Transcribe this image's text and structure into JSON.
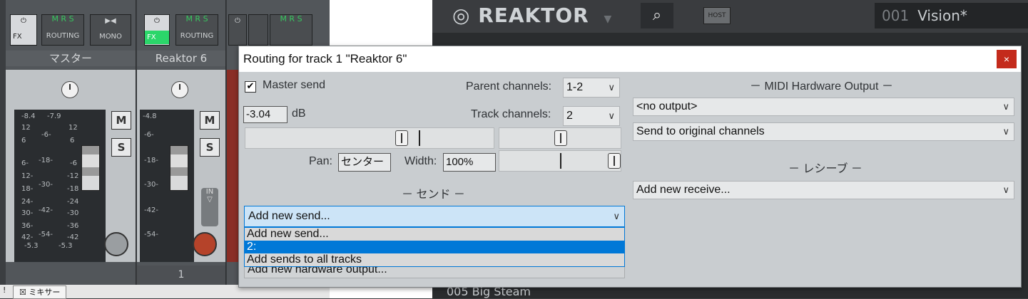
{
  "mixer": {
    "top_buttons": {
      "fx": "FX",
      "routing": "ROUTING",
      "mono": "MONO",
      "m": "M",
      "r": "R",
      "s": "S",
      "in": "IN"
    },
    "strips": [
      {
        "name": "マスター",
        "meter_labels": [
          "-8.4",
          "-7.9",
          "12",
          "-6-",
          "12",
          "6",
          "6",
          "6-",
          "-18-",
          "-6",
          "12-",
          "-12",
          "18-",
          "-30-",
          "-18",
          "24-",
          "-24",
          "30-",
          "-42-",
          "-30",
          "36-",
          "-36",
          "42-",
          "-54-",
          "-42",
          "-5.3",
          "-5.3"
        ]
      },
      {
        "name": "Reaktor 6",
        "number": "1",
        "meter_labels": [
          "-4.8",
          "-6-",
          "-18-",
          "-30-",
          "-42-",
          "-54-"
        ]
      }
    ],
    "m_label": "M",
    "s_label": "S",
    "bottom_tab": "ミキサー",
    "bottom_prefix": "!"
  },
  "reaktor": {
    "logo": "REAKTOR",
    "host_label": "HOST",
    "preset_number": "001",
    "preset_name": "Vision*",
    "list_item": "005   Big Steam"
  },
  "dialog": {
    "title": "Routing for track 1 \"Reaktor 6\"",
    "close_label": "×",
    "master_send_label": "Master send",
    "master_send_checked": true,
    "parent_channels_label": "Parent channels:",
    "parent_channels_value": "1-2",
    "volume_value": "-3.04",
    "volume_unit": "dB",
    "track_channels_label": "Track channels:",
    "track_channels_value": "2",
    "pan_label": "Pan:",
    "pan_value": "センター",
    "width_label": "Width:",
    "width_value": "100%",
    "sends_header": "－ センド －",
    "send_combo_value": "Add new send...",
    "send_dropdown_items": [
      "Add new send...",
      "2:",
      "Add sends to all tracks"
    ],
    "send_dropdown_selected_index": 1,
    "hw_output_value": "Add new hardware output...",
    "midi_hw_header": "－  MIDI Hardware Output  －",
    "midi_output_value": "<no output>",
    "midi_channel_value": "Send to original channels",
    "receives_header": "－  レシーブ  －",
    "receive_combo_value": "Add new receive..."
  },
  "colors": {
    "accent_blue": "#0078d7",
    "close_red": "#c42b1c",
    "fx_green": "#2bd66a",
    "dialog_bg": "#c9cdd0"
  }
}
